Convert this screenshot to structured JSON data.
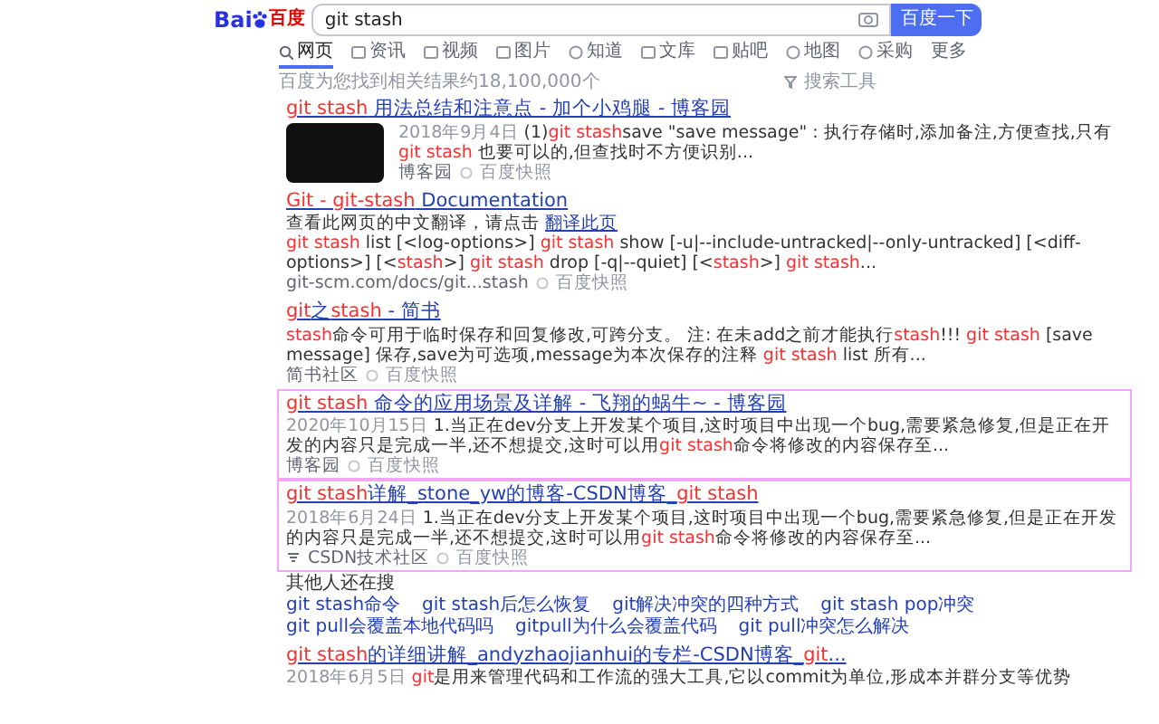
{
  "header": {
    "logo_latin": "Bai",
    "logo_cjk": "百度",
    "search_value": "git stash",
    "search_button": "百度一下"
  },
  "tabs": [
    {
      "label": "网页",
      "selected": true
    },
    {
      "label": "资讯",
      "selected": false
    },
    {
      "label": "视频",
      "selected": false
    },
    {
      "label": "图片",
      "selected": false
    },
    {
      "label": "知道",
      "selected": false
    },
    {
      "label": "文库",
      "selected": false
    },
    {
      "label": "贴吧",
      "selected": false
    },
    {
      "label": "地图",
      "selected": false
    },
    {
      "label": "采购",
      "selected": false
    },
    {
      "label": "更多",
      "selected": false
    }
  ],
  "result_count": "百度为您找到相关结果约18,100,000个",
  "search_tools": "搜索工具",
  "results": [
    {
      "title": "**git stash** 用法总结和注意点 - 加个小鸡腿 - 博客园",
      "thumbnail": true,
      "highlighted": false,
      "date": "2018年9月4日",
      "snippet": "(1)**git stash**save \"save message\" : 执行存储时,添加备注,方便查找,只有**git stash** 也要可以的,但查找时不方便识别...",
      "source": "博客园",
      "cache": "百度快照"
    },
    {
      "title": "**Git - git-stash** Documentation",
      "thumbnail": false,
      "highlighted": false,
      "translate_text": "查看此网页的中文翻译，请点击",
      "translate_link": "翻译此页",
      "snippet": "**git stash** list [<log-options>] **git stash** show [-u|--include-untracked|--only-untracked] [<diff-options>] [<**stash**>] **git stash** drop [-q|--quiet] [<**stash**>] **git stash**...",
      "source": "git-scm.com/docs/git...stash",
      "cache": "百度快照"
    },
    {
      "title": "**git**之**stash** - 简书",
      "thumbnail": false,
      "highlighted": false,
      "snippet": "**stash**命令可用于临时保存和回复修改,可跨分支。 注: 在未add之前才能执行**stash**!!! **git stash** [save message] 保存,save为可选项,message为本次保存的注释 **git stash** list 所有...",
      "source": "简书社区",
      "cache": "百度快照"
    },
    {
      "title": "**git stash** 命令的应用场景及详解 - 飞翔的蜗牛~ - 博客园",
      "thumbnail": false,
      "highlighted": true,
      "date": "2020年10月15日",
      "snippet": "1.当正在dev分支上开发某个项目,这时项目中出现一个bug,需要紧急修复,但是正在开发的内容只是完成一半,还不想提交,这时可以用**git stash**命令将修改的内容保存至...",
      "source": "博客园",
      "cache": "百度快照"
    },
    {
      "title": "**git stash**详解_stone_yw的博客-CSDN博客_**git stash**",
      "thumbnail": false,
      "highlighted": true,
      "date": "2018年6月24日",
      "snippet": "1.当正在dev分支上开发某个项目,这时项目中出现一个bug,需要紧急修复,但是正在开发的内容只是完成一半,还不想提交,这时可以用**git stash**命令将修改的内容保存至...",
      "source_icon": true,
      "source": "CSDN技术社区",
      "cache": "百度快照"
    }
  ],
  "related": {
    "title": "其他人还在搜",
    "items": [
      "git stash命令",
      "git stash后怎么恢复",
      "git解决冲突的四种方式",
      "git stash pop冲突",
      "git pull会覆盖本地代码吗",
      "gitpull为什么会覆盖代码",
      "git pull冲突怎么解决"
    ]
  },
  "last_result": {
    "title": "**git stash**的详细讲解_andyzhaojianhui的专栏-CSDN博客_**git**...",
    "date": "2018年6月5日",
    "snippet": "**git**是用来管理代码和工作流的强大工具,它以commit为单位,形成本并群分支等优势"
  }
}
